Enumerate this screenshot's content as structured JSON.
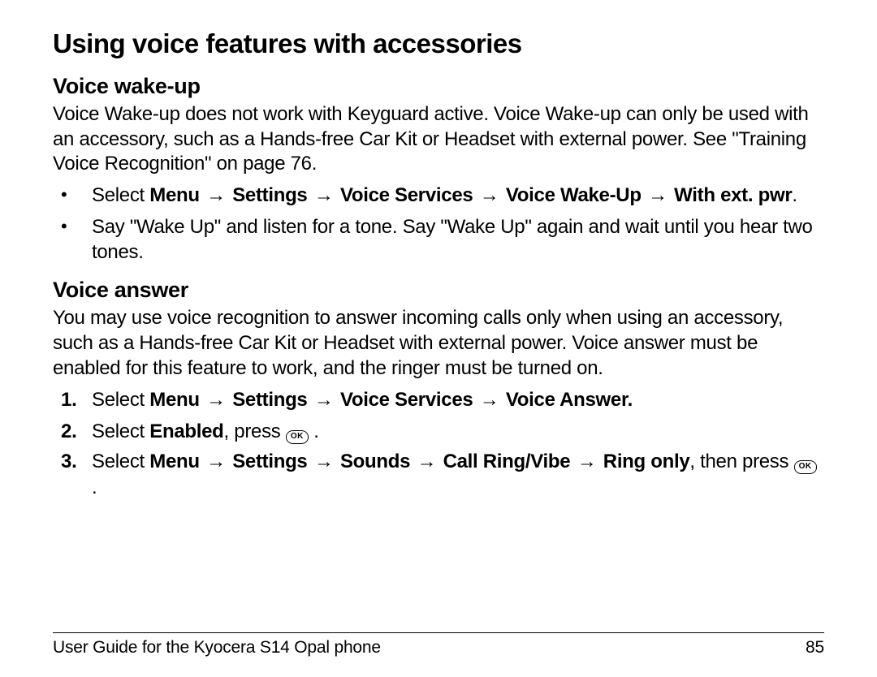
{
  "title": "Using voice features with accessories",
  "section1": {
    "heading": "Voice wake-up",
    "para": "Voice Wake-up does not work with Keyguard active. Voice Wake-up can only be used with an accessory, such as a Hands-free Car Kit or Headset with external power. See \"Training Voice Recognition\" on page 76.",
    "bullet1_select": "Select ",
    "bullet1_menu": "Menu",
    "bullet1_settings": "Settings",
    "bullet1_voice_services": "Voice Services",
    "bullet1_voice_wakeup": "Voice Wake-Up",
    "bullet1_with_ext": "With ext. pwr",
    "bullet1_period": ".",
    "bullet2": "Say \"Wake Up\" and listen for a tone. Say \"Wake Up\" again and wait until you hear two tones."
  },
  "section2": {
    "heading": "Voice answer",
    "para": "You may use voice recognition to answer incoming calls only when using an accessory, such as a Hands-free Car Kit or Headset with external power. Voice answer must be enabled for this feature to work, and the ringer must be turned on.",
    "step1_select": "Select ",
    "step1_menu": "Menu",
    "step1_settings": "Settings",
    "step1_voice_services": "Voice Services",
    "step1_voice_answer": "Voice Answer.",
    "step2_select": "Select ",
    "step2_enabled": "Enabled",
    "step2_press": ", press ",
    "step2_end": ".",
    "step3_select": "Select ",
    "step3_menu": "Menu",
    "step3_settings": "Settings",
    "step3_sounds": "Sounds",
    "step3_call_ring": "Call Ring/Vibe",
    "step3_ring_only": "Ring only",
    "step3_then": ", then press ",
    "step3_end": "."
  },
  "arrow": "→",
  "ok_label": "OK",
  "footer": {
    "guide": "User Guide for the Kyocera S14 Opal phone",
    "page": "85"
  }
}
